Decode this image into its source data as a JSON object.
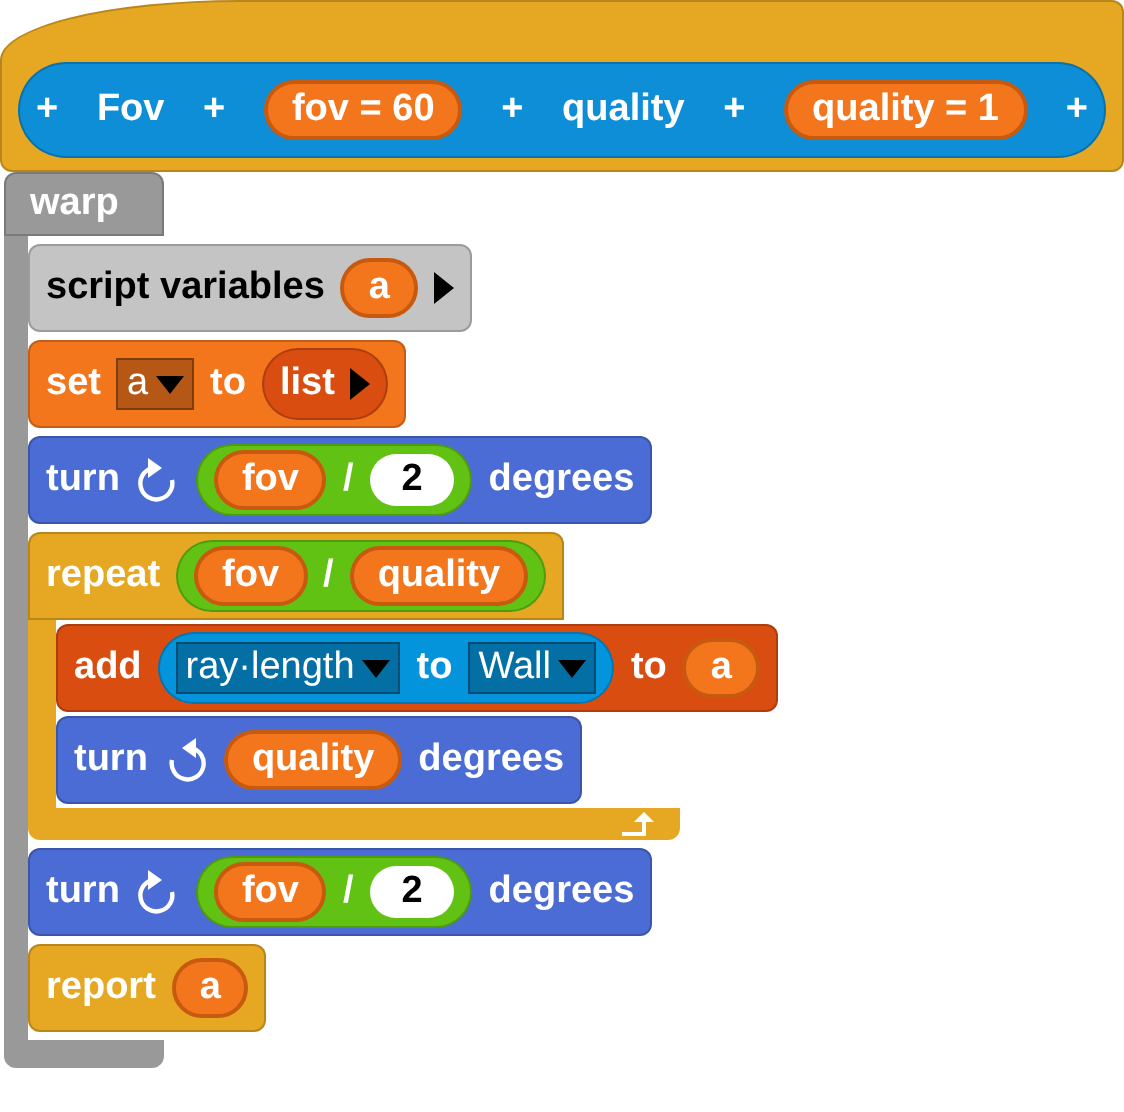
{
  "definition": {
    "parts": [
      {
        "kind": "plus",
        "text": "+"
      },
      {
        "kind": "label",
        "text": "Fov"
      },
      {
        "kind": "plus",
        "text": "+"
      },
      {
        "kind": "param",
        "text": "fov = 60"
      },
      {
        "kind": "plus",
        "text": "+"
      },
      {
        "kind": "label",
        "text": "quality"
      },
      {
        "kind": "plus",
        "text": "+"
      },
      {
        "kind": "param",
        "text": "quality = 1"
      },
      {
        "kind": "plus",
        "text": "+"
      }
    ]
  },
  "warp": {
    "label": "warp",
    "body": [
      {
        "color": "#c4c4c4",
        "parts": [
          {
            "kind": "label",
            "text": "script variables"
          },
          {
            "kind": "var",
            "text": "a"
          },
          {
            "kind": "arrow"
          }
        ]
      },
      {
        "color": "#f3761d",
        "parts": [
          {
            "kind": "label",
            "text": "set"
          },
          {
            "kind": "dropdown",
            "text": "a"
          },
          {
            "kind": "label",
            "text": "to"
          },
          {
            "kind": "reporter",
            "color": "#d94d11",
            "parts": [
              {
                "kind": "label",
                "text": "list"
              },
              {
                "kind": "arrow"
              }
            ]
          }
        ]
      },
      {
        "color": "#4a6cd4",
        "parts": [
          {
            "kind": "label",
            "text": "turn"
          },
          {
            "kind": "clockwise"
          },
          {
            "kind": "reporter",
            "color": "#62c213",
            "parts": [
              {
                "kind": "var",
                "text": "fov"
              },
              {
                "kind": "label",
                "text": "/"
              },
              {
                "kind": "num",
                "text": "2"
              }
            ]
          },
          {
            "kind": "label",
            "text": "degrees"
          }
        ]
      },
      {
        "color": "#e6a822",
        "loop": true,
        "parts": [
          {
            "kind": "label",
            "text": "repeat"
          },
          {
            "kind": "reporter",
            "color": "#62c213",
            "parts": [
              {
                "kind": "var",
                "text": "fov"
              },
              {
                "kind": "label",
                "text": "/"
              },
              {
                "kind": "var",
                "text": "quality"
              }
            ]
          }
        ],
        "body": [
          {
            "color": "#d94d11",
            "parts": [
              {
                "kind": "label",
                "text": "add"
              },
              {
                "kind": "reporter",
                "color": "#0494dc",
                "parts": [
                  {
                    "kind": "dropdown",
                    "text": "ray·length"
                  },
                  {
                    "kind": "label",
                    "text": "to"
                  },
                  {
                    "kind": "dropdown",
                    "text": "Wall"
                  }
                ]
              },
              {
                "kind": "label",
                "text": "to"
              },
              {
                "kind": "var",
                "text": "a"
              }
            ]
          },
          {
            "color": "#4a6cd4",
            "parts": [
              {
                "kind": "label",
                "text": "turn"
              },
              {
                "kind": "counterclockwise"
              },
              {
                "kind": "var",
                "text": "quality"
              },
              {
                "kind": "label",
                "text": "degrees"
              }
            ]
          }
        ]
      },
      {
        "color": "#4a6cd4",
        "parts": [
          {
            "kind": "label",
            "text": "turn"
          },
          {
            "kind": "clockwise"
          },
          {
            "kind": "reporter",
            "color": "#62c213",
            "parts": [
              {
                "kind": "var",
                "text": "fov"
              },
              {
                "kind": "label",
                "text": "/"
              },
              {
                "kind": "num",
                "text": "2"
              }
            ]
          },
          {
            "kind": "label",
            "text": "degrees"
          }
        ]
      },
      {
        "color": "#e6a822",
        "parts": [
          {
            "kind": "label",
            "text": "report"
          },
          {
            "kind": "var",
            "text": "a"
          }
        ]
      }
    ]
  }
}
